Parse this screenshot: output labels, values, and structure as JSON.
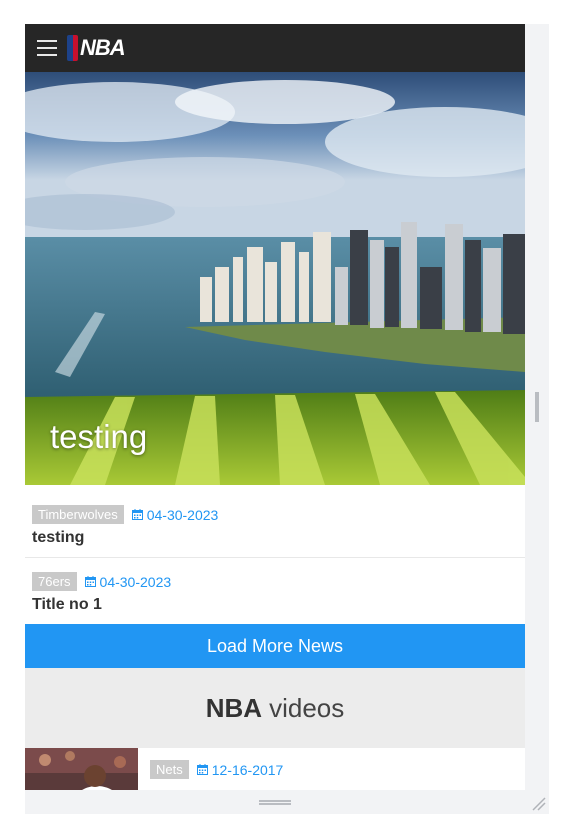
{
  "brand": {
    "logo_text": "NBA"
  },
  "hero": {
    "title": "testing"
  },
  "news": [
    {
      "team": "Timberwolves",
      "date": "04-30-2023",
      "title": "testing"
    },
    {
      "team": "76ers",
      "date": "04-30-2023",
      "title": "Title no 1"
    }
  ],
  "load_more_label": "Load More News",
  "videos_section": {
    "title_bold": "NBA",
    "title_light": "videos"
  },
  "videos": [
    {
      "team": "Nets",
      "date": "12-16-2017"
    }
  ],
  "colors": {
    "accent": "#2196f3",
    "navbar": "#262626",
    "tag": "#c9c9c9"
  }
}
